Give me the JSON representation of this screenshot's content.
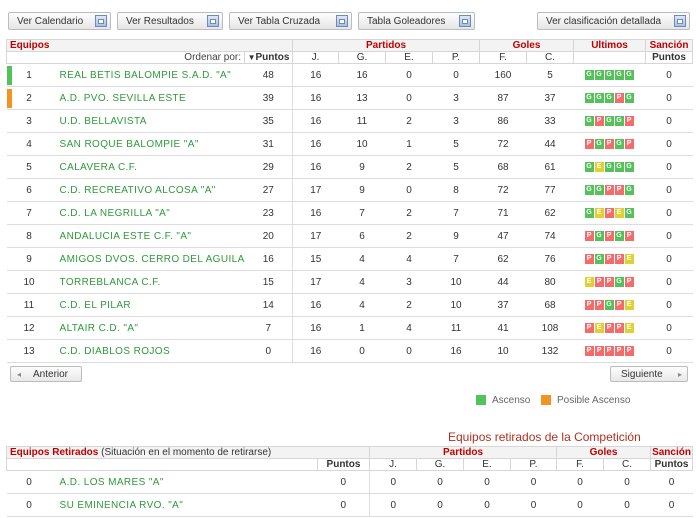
{
  "toolbar": {
    "buttons": [
      "Ver Calendario",
      "Ver Resultados",
      "Ver Tabla Cruzada",
      "Tabla Goleadores",
      "Ver clasificación detallada"
    ]
  },
  "table": {
    "headers": {
      "equipos": "Equipos",
      "partidos": "Partidos",
      "goles": "Goles",
      "ultimos": "Últimos",
      "sancion": "Sanción"
    },
    "order_by": "Ordenar por:",
    "sub": {
      "puntos": "Puntos",
      "j": "J.",
      "g": "G.",
      "e": "E.",
      "p": "P.",
      "f": "F.",
      "c": "C.",
      "puntos2": "Puntos"
    },
    "rows": [
      {
        "pos": "1",
        "team": "REAL BETIS BALOMPIE S.A.D. \"A\"",
        "pts": "48",
        "j": "16",
        "g": "16",
        "e": "0",
        "p": "0",
        "f": "160",
        "c": "5",
        "form": "GGGGG",
        "sancion": "0",
        "mark": "#52c35a"
      },
      {
        "pos": "2",
        "team": "A.D. PVO. SEVILLA ESTE",
        "pts": "39",
        "j": "16",
        "g": "13",
        "e": "0",
        "p": "3",
        "f": "87",
        "c": "37",
        "form": "GGGPG",
        "sancion": "0",
        "mark": "#f39422"
      },
      {
        "pos": "3",
        "team": "U.D. BELLAVISTA",
        "pts": "35",
        "j": "16",
        "g": "11",
        "e": "2",
        "p": "3",
        "f": "86",
        "c": "33",
        "form": "GPGGP",
        "sancion": "0",
        "mark": ""
      },
      {
        "pos": "4",
        "team": "SAN ROQUE BALOMPIE \"A\"",
        "pts": "31",
        "j": "16",
        "g": "10",
        "e": "1",
        "p": "5",
        "f": "72",
        "c": "44",
        "form": "PGPGP",
        "sancion": "0",
        "mark": ""
      },
      {
        "pos": "5",
        "team": "CALAVERA C.F.",
        "pts": "29",
        "j": "16",
        "g": "9",
        "e": "2",
        "p": "5",
        "f": "68",
        "c": "61",
        "form": "GEGGG",
        "sancion": "0",
        "mark": ""
      },
      {
        "pos": "6",
        "team": "C.D. RECREATIVO ALCOSA \"A\"",
        "pts": "27",
        "j": "17",
        "g": "9",
        "e": "0",
        "p": "8",
        "f": "72",
        "c": "77",
        "form": "GGPPG",
        "sancion": "0",
        "mark": ""
      },
      {
        "pos": "7",
        "team": "C.D. LA NEGRILLA \"A\"",
        "pts": "23",
        "j": "16",
        "g": "7",
        "e": "2",
        "p": "7",
        "f": "71",
        "c": "62",
        "form": "GEPEG",
        "sancion": "0",
        "mark": ""
      },
      {
        "pos": "8",
        "team": "ANDALUCIA ESTE C.F. \"A\"",
        "pts": "20",
        "j": "17",
        "g": "6",
        "e": "2",
        "p": "9",
        "f": "47",
        "c": "74",
        "form": "PGPGP",
        "sancion": "0",
        "mark": ""
      },
      {
        "pos": "9",
        "team": "AMIGOS DVOS. CERRO DEL AGUILA",
        "pts": "16",
        "j": "15",
        "g": "4",
        "e": "4",
        "p": "7",
        "f": "62",
        "c": "76",
        "form": "PGPPE",
        "sancion": "0",
        "mark": ""
      },
      {
        "pos": "10",
        "team": "TORREBLANCA C.F.",
        "pts": "15",
        "j": "17",
        "g": "4",
        "e": "3",
        "p": "10",
        "f": "44",
        "c": "80",
        "form": "EPPGP",
        "sancion": "0",
        "mark": ""
      },
      {
        "pos": "11",
        "team": "C.D. EL PILAR",
        "pts": "14",
        "j": "16",
        "g": "4",
        "e": "2",
        "p": "10",
        "f": "37",
        "c": "68",
        "form": "PPGPE",
        "sancion": "0",
        "mark": ""
      },
      {
        "pos": "12",
        "team": "ALTAIR C.D. \"A\"",
        "pts": "7",
        "j": "16",
        "g": "1",
        "e": "4",
        "p": "11",
        "f": "41",
        "c": "108",
        "form": "PEPPE",
        "sancion": "0",
        "mark": ""
      },
      {
        "pos": "13",
        "team": "C.D. DIABLOS ROJOS",
        "pts": "0",
        "j": "16",
        "g": "0",
        "e": "0",
        "p": "16",
        "f": "10",
        "c": "132",
        "form": "PPPPP",
        "sancion": "0",
        "mark": ""
      }
    ]
  },
  "nav": {
    "prev": "Anterior",
    "next": "Siguiente"
  },
  "legend": {
    "ascenso": "Ascenso",
    "posible": "Posible Ascenso",
    "ascenso_color": "#52c35a",
    "posible_color": "#f39422"
  },
  "retired": {
    "title": "Equipos retirados de la Competición",
    "header_main": "Equipos Retirados",
    "header_note": "(Situación en el momento de retirarse)",
    "partidos": "Partidos",
    "goles": "Goles",
    "sancion": "Sanción",
    "sub": {
      "puntos": "Puntos",
      "j": "J.",
      "g": "G.",
      "e": "E.",
      "p": "P.",
      "f": "F.",
      "c": "C.",
      "puntos2": "Puntos"
    },
    "rows": [
      {
        "pos": "0",
        "team": "A.D. LOS MARES \"A\"",
        "pts": "0",
        "j": "0",
        "g": "0",
        "e": "0",
        "p": "0",
        "f": "0",
        "c": "0",
        "sancion": "0"
      },
      {
        "pos": "0",
        "team": "SU EMINENCIA RVO. \"A\"",
        "pts": "0",
        "j": "0",
        "g": "0",
        "e": "0",
        "p": "0",
        "f": "0",
        "c": "0",
        "sancion": "0"
      }
    ]
  }
}
